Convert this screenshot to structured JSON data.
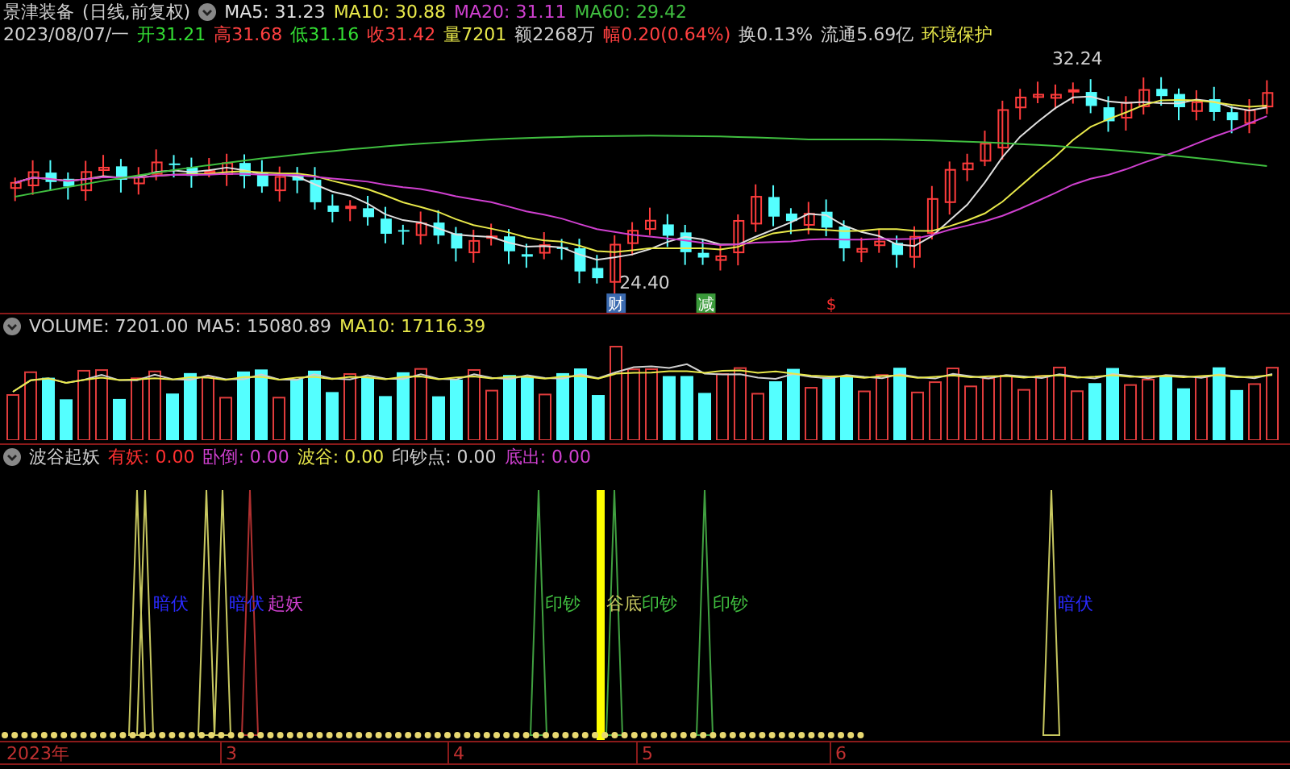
{
  "header": {
    "name": "景津装备",
    "period": "(日线,前复权)",
    "ma": [
      {
        "label": "MA5: 31.23",
        "color": "#e0e0e0"
      },
      {
        "label": "MA10: 30.88",
        "color": "#e8e84a"
      },
      {
        "label": "MA20: 31.11",
        "color": "#d040d0"
      },
      {
        "label": "MA60: 29.42",
        "color": "#40c040"
      }
    ]
  },
  "quote": {
    "date": "2023/08/07/一",
    "fields": [
      {
        "text": "开31.21",
        "color": "#33dd33"
      },
      {
        "text": "高31.68",
        "color": "#ff4040"
      },
      {
        "text": "低31.16",
        "color": "#33dd33"
      },
      {
        "text": "收31.42",
        "color": "#ff4040"
      },
      {
        "text": "量7201",
        "color": "#e8e84a"
      },
      {
        "text": "额2268万",
        "color": "#d0d0d0"
      },
      {
        "text": "幅0.20(0.64%)",
        "color": "#ff4040"
      },
      {
        "text": "换0.13%",
        "color": "#d0d0d0"
      },
      {
        "text": "流通5.69亿",
        "color": "#d0d0d0"
      },
      {
        "text": "环境保护",
        "color": "#e8e84a"
      }
    ]
  },
  "price_chart": {
    "high_label": "32.24",
    "low_label": "24.40",
    "events": [
      {
        "label": "财",
        "color": "#3a6ab0"
      },
      {
        "label": "减",
        "color": "#3a9a3a"
      },
      {
        "label": "$",
        "color": "#ff3030"
      }
    ]
  },
  "volume": {
    "fields": [
      {
        "text": "VOLUME: 7201.00",
        "color": "#d0d0d0"
      },
      {
        "text": "MA5: 15080.89",
        "color": "#d0d0d0"
      },
      {
        "text": "MA10: 17116.39",
        "color": "#e8e84a"
      }
    ]
  },
  "indicator": {
    "name": "波谷起妖",
    "fields": [
      {
        "text": "有妖: 0.00",
        "color": "#ff3030"
      },
      {
        "text": "卧倒: 0.00",
        "color": "#d040d0"
      },
      {
        "text": "波谷: 0.00",
        "color": "#e8e84a"
      },
      {
        "text": "印钞点: 0.00",
        "color": "#d0d0d0"
      },
      {
        "text": "底出: 0.00",
        "color": "#d040d0"
      }
    ],
    "signals": [
      {
        "label": "暗伏",
        "color": "#2a2aff"
      },
      {
        "label": "暗伏",
        "color": "#2a2aff"
      },
      {
        "label": "起妖",
        "color": "#d040d0"
      },
      {
        "label": "印钞",
        "color": "#40c040"
      },
      {
        "label": "谷底",
        "color": "#c8c860"
      },
      {
        "label": "印钞",
        "color": "#40c040"
      },
      {
        "label": "印钞",
        "color": "#40c040"
      },
      {
        "label": "暗伏",
        "color": "#2a2aff"
      }
    ]
  },
  "axis": [
    "2023年",
    "3",
    "4",
    "5",
    "6"
  ]
}
